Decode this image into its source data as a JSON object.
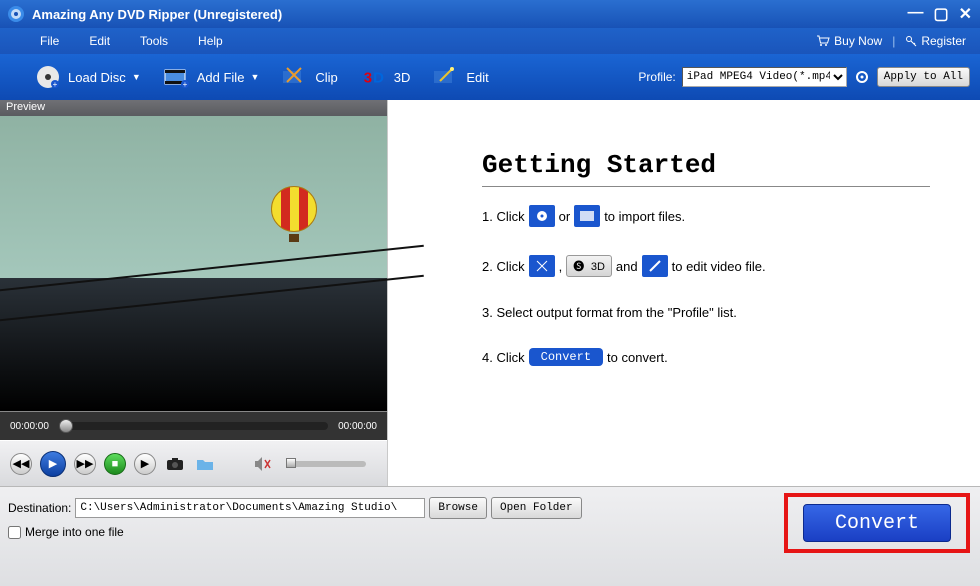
{
  "title": "Amazing Any DVD Ripper (Unregistered)",
  "menu": {
    "file": "File",
    "edit": "Edit",
    "tools": "Tools",
    "help": "Help"
  },
  "header_links": {
    "buy": "Buy Now",
    "register": "Register"
  },
  "toolbar": {
    "load_disc": "Load Disc",
    "add_file": "Add File",
    "clip": "Clip",
    "threeD": "3D",
    "edit": "Edit",
    "profile_label": "Profile:",
    "profile_value": "iPad MPEG4 Video(*.mp4)",
    "apply_all": "Apply to All"
  },
  "preview": {
    "label": "Preview",
    "time_start": "00:00:00",
    "time_end": "00:00:00"
  },
  "getting_started": {
    "heading": "Getting Started",
    "s1a": "1. Click ",
    "s1b": " or ",
    "s1c": " to import files.",
    "s2a": "2. Click ",
    "s2b": ", ",
    "s2c": " and ",
    "s2d": " to edit video file.",
    "s2_3d": "3D",
    "s3": "3. Select output format from the \"Profile\" list.",
    "s4a": "4. Click ",
    "s4_btn": "Convert",
    "s4b": " to convert."
  },
  "bottom": {
    "dest_label": "Destination:",
    "dest_path": "C:\\Users\\Administrator\\Documents\\Amazing Studio\\",
    "browse": "Browse",
    "open_folder": "Open Folder",
    "merge": "Merge into one file",
    "convert": "Convert"
  }
}
